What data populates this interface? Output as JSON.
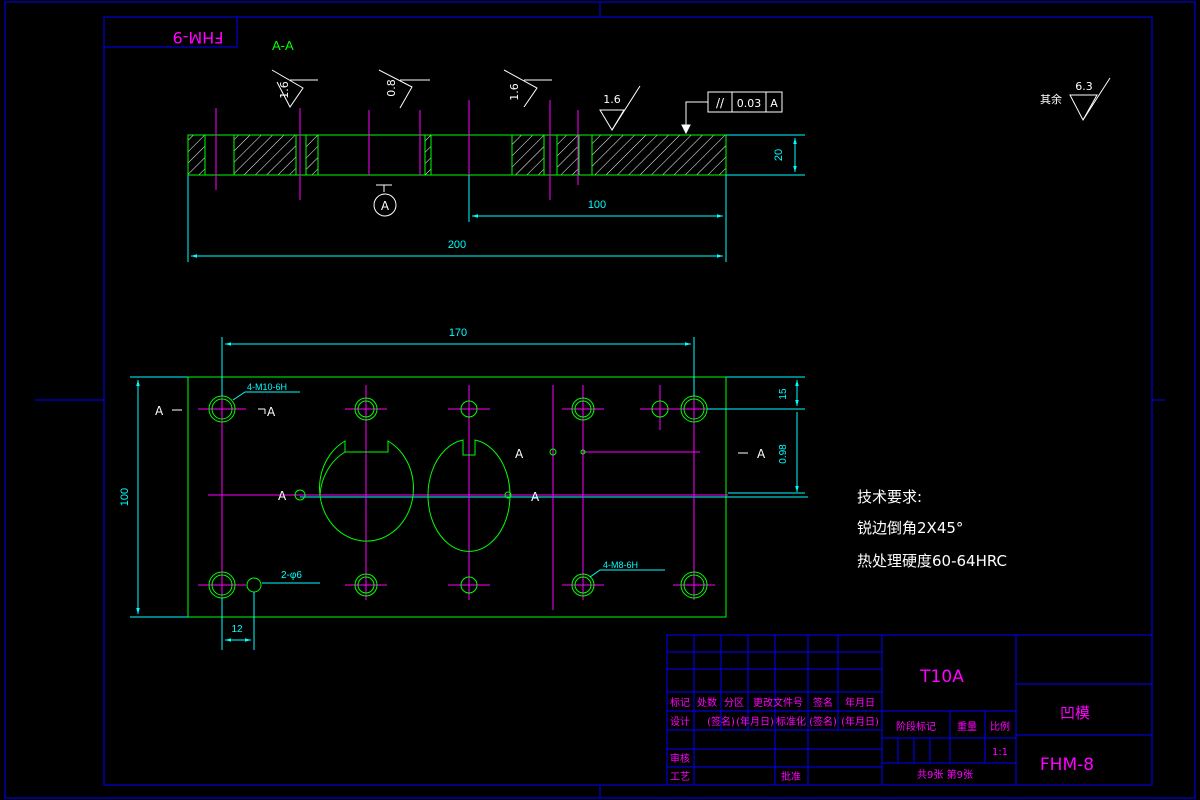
{
  "sheet_code_top": "FHM-9",
  "section_label": "A-A",
  "section_marker": "A",
  "roughness": {
    "r1": "1.6",
    "r2": "0.8",
    "r3": "1.6",
    "r4": "1.6",
    "rest_label": "其余",
    "rest_value": "6.3"
  },
  "tolerance": {
    "symbol": "//",
    "value": "0.03",
    "datum": "A"
  },
  "dimensions": {
    "thickness": "20",
    "d100_top": "100",
    "d200": "200",
    "d170": "170",
    "d15": "15",
    "d098": "0.98",
    "d100_left": "100",
    "d12": "12"
  },
  "callouts": {
    "thread_m10": "4-M10-6H",
    "thread_m8": "4-M8-6H",
    "hole_d6": "2-φ6"
  },
  "section_cut_labels": {
    "left": "A",
    "left_arrow": "A",
    "right": "A",
    "mid1": "A",
    "mid2": "A",
    "mid3": "A"
  },
  "tech_requirements": {
    "title": "技术要求:",
    "line1": "锐边倒角2X45°",
    "line2": "热处理硬度60-64HRC"
  },
  "title_block": {
    "material": "T10A",
    "part_name": "凹模",
    "drawing_no": "FHM-8",
    "h_biaoji": "标记",
    "h_chushu": "处数",
    "h_fenqu": "分区",
    "h_gengai": "更改文件号",
    "h_qianming": "签名",
    "h_nianyueri": "年月日",
    "r_sheji": "设计",
    "r_qianming": "(签名)",
    "r_nianyueri": "(年月日)",
    "r_biaozhunhua": "标准化",
    "r_qianming2": "(签名)",
    "r_nianyueri2": "(年月日)",
    "r_shenhe": "审核",
    "r_gongyi": "工艺",
    "r_pizhun": "批准",
    "jieduan": "阶段标记",
    "zhongliang": "重量",
    "bili": "比例",
    "scale": "1:1",
    "sheets": "共9张 第9张"
  },
  "colors": {
    "background": "#000000",
    "outline": "#00ff00",
    "dimension": "#00ffff",
    "centerline": "#ff00ff",
    "frame": "#0000ff",
    "text": "#ffffff"
  }
}
